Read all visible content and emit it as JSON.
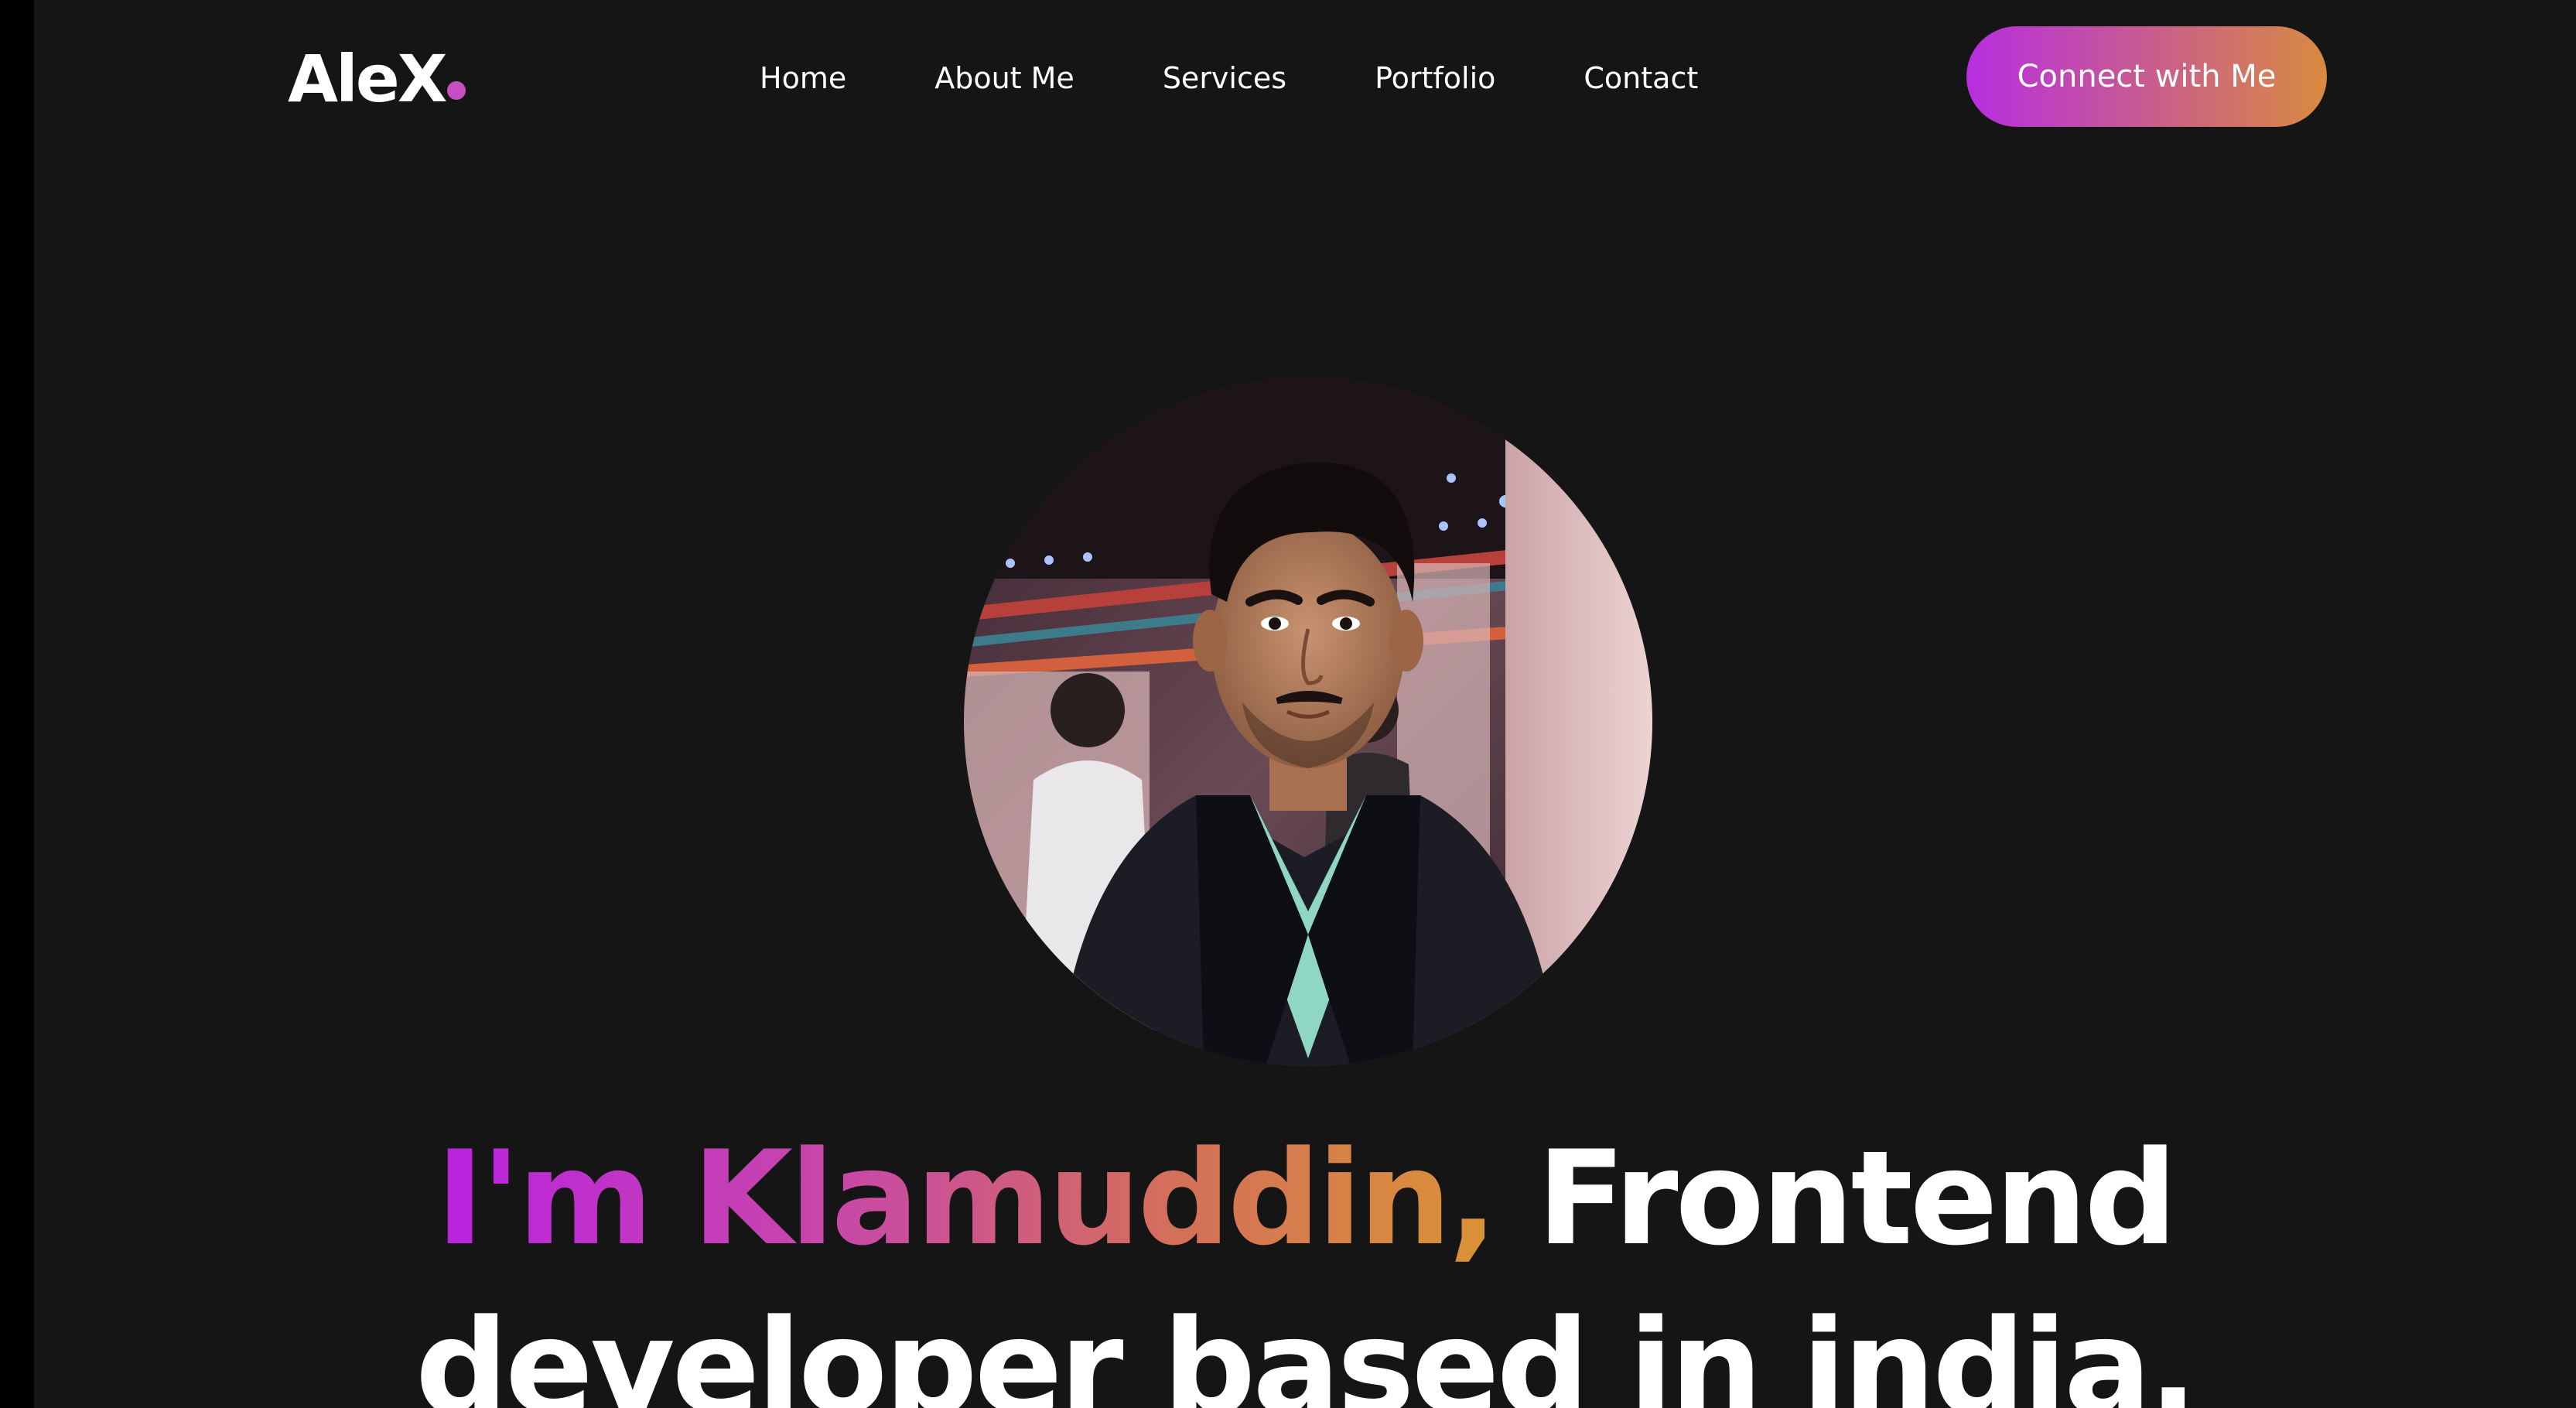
{
  "logo": {
    "text": "AleX",
    "dot_color": "#c54fc2"
  },
  "nav": {
    "items": [
      {
        "label": "Home"
      },
      {
        "label": "About Me"
      },
      {
        "label": "Services"
      },
      {
        "label": "Portfolio"
      },
      {
        "label": "Contact"
      }
    ]
  },
  "cta": {
    "label": "Connect with Me",
    "gradient_start": "#b72ee0",
    "gradient_end": "#d98a40"
  },
  "hero": {
    "highlight": "I'm Klamuddin,",
    "rest_line1": " Frontend",
    "line2": "developer based in india."
  },
  "colors": {
    "background": "#161515",
    "text": "#ffffff",
    "gradient_start": "#b923e1",
    "gradient_end": "#da9335"
  }
}
